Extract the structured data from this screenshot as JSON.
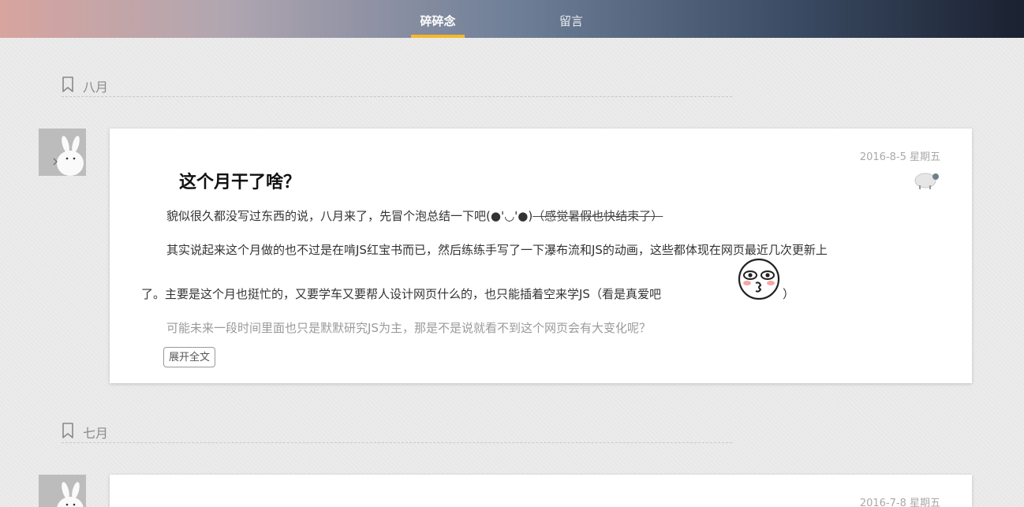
{
  "nav": {
    "items": [
      {
        "label": "碎碎念",
        "active": true
      },
      {
        "label": "留言",
        "active": false
      }
    ],
    "accent": "#f5b82a"
  },
  "sections": [
    {
      "month": "八月",
      "post": {
        "date": "2016-8-5 星期五",
        "title": "这个月干了啥？",
        "p1_text": "貌似很久都没写过东西的说，八月来了，先冒个泡总结一下吧(●'◡'●)",
        "p1_strike": "（感觉暑假也快结束了）",
        "p2_line1": "其实说起来这个月做的也不过是在啃JS红宝书而已，然后练练手写了一下瀑布流和JS的动画，这些都体现在网页最近几次更新上",
        "p2_line2": "了。主要是这个月也挺忙的，又要学车又要帮人设计网页什么的，也只能插着空来学JS（看是真爱吧",
        "p2_tail": "）",
        "p3": "可能未来一段时间里面也只是默默研究JS为主，那是不是说就看不到这个网页会有大变化呢？",
        "expand_label": "展开全文"
      }
    },
    {
      "month": "七月",
      "post": {
        "date": "2016-7-8 星期五"
      }
    }
  ],
  "icons": {
    "bookmark": "bookmark-icon",
    "sheep": "sheep-icon",
    "emoji": "blushing-face-emoji",
    "avatar": "rabbit-avatar"
  }
}
